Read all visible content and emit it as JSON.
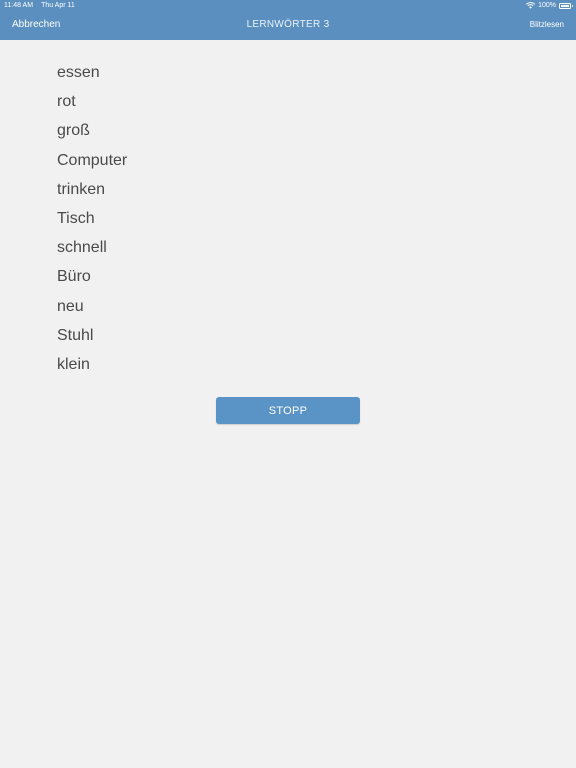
{
  "status_bar": {
    "time": "11:48 AM",
    "date": "Thu Apr 11",
    "battery": "100%",
    "wifi_icon": "wifi-icon",
    "battery_icon": "battery-full-icon"
  },
  "nav": {
    "cancel_label": "Abbrechen",
    "title": "LERNWÖRTER 3",
    "right_label": "Blitzlesen"
  },
  "words": [
    "essen",
    "rot",
    "groß",
    "Computer",
    "trinken",
    "Tisch",
    "schnell",
    "Büro",
    "neu",
    "Stuhl",
    "klein"
  ],
  "stop_button": {
    "label": "STOPP"
  },
  "colors": {
    "header": "#5a8fbf",
    "button": "#5a93c6",
    "background": "#f1f1f1",
    "word_text": "#4a4a4a"
  }
}
